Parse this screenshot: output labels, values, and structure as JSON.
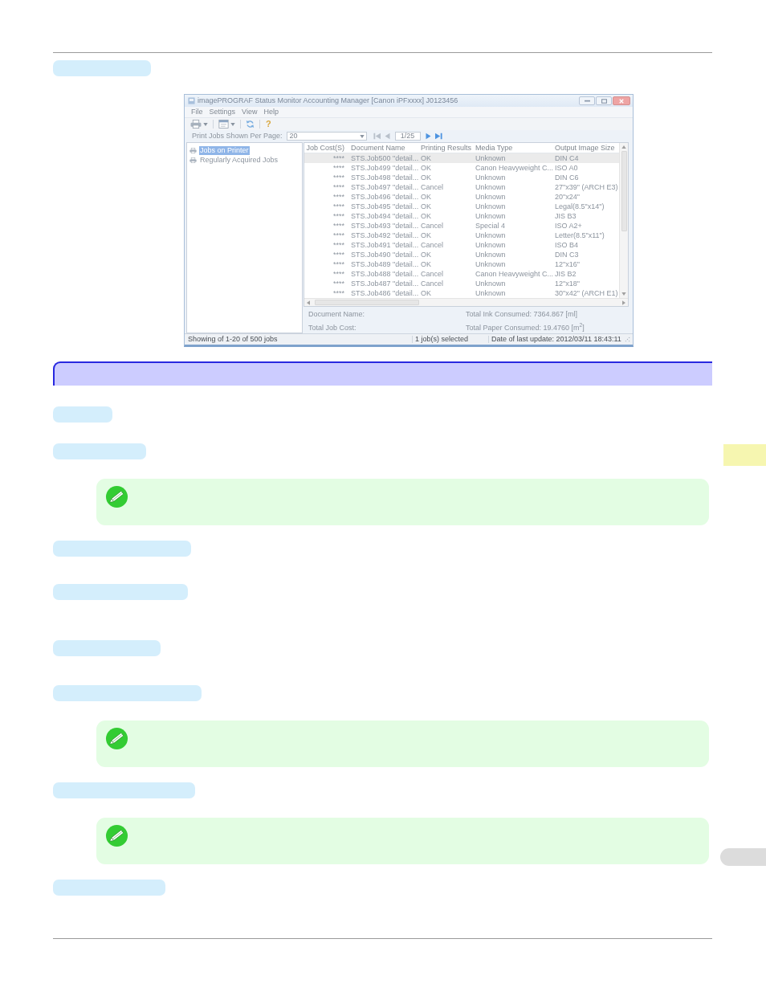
{
  "page": {
    "blocks": [
      {
        "kind": "bar"
      },
      {
        "kind": "screenshot",
        "window": {
          "title": "imagePROGRAF Status Monitor Accounting Manager [Canon iPFxxxx] J0123456",
          "menu": [
            "File",
            "Settings",
            "View",
            "Help"
          ],
          "toolbar": [
            {
              "kind": "printer-menu"
            },
            {
              "kind": "document-menu"
            },
            {
              "kind": "refresh"
            },
            {
              "kind": "help",
              "glyph": "?"
            }
          ],
          "per_page": {
            "label": "Print Jobs Shown Per Page:",
            "value": "20"
          },
          "pager": [
            {
              "kind": "first",
              "disabled": true
            },
            {
              "kind": "previous",
              "disabled": true
            },
            {
              "kind": "page",
              "value": "1/25"
            },
            {
              "kind": "next",
              "disabled": false
            },
            {
              "kind": "last",
              "disabled": false
            }
          ],
          "tree": [
            {
              "label": "Jobs on Printer",
              "selected": true
            },
            {
              "label": "Regularly Acquired Jobs",
              "selected": false
            }
          ],
          "table": {
            "columns": [
              "Job Cost(S)",
              "Document Name",
              "Printing Results",
              "Media Type",
              "Output Image Size"
            ],
            "rows": [
              {
                "cells": [
                  "****",
                  "STS.Job500 \"detail...",
                  "OK",
                  "Unknown",
                  "DIN C4"
                ],
                "selected": true
              },
              {
                "cells": [
                  "****",
                  "STS.Job499 \"detail...",
                  "OK",
                  "Canon Heavyweight C...",
                  "ISO A0"
                ],
                "selected": false
              },
              {
                "cells": [
                  "****",
                  "STS.Job498 \"detail...",
                  "OK",
                  "Unknown",
                  "DIN C6"
                ],
                "selected": false
              },
              {
                "cells": [
                  "****",
                  "STS.Job497 \"detail...",
                  "Cancel",
                  "Unknown",
                  "27\"x39\" (ARCH E3)"
                ],
                "selected": false
              },
              {
                "cells": [
                  "****",
                  "STS.Job496 \"detail...",
                  "OK",
                  "Unknown",
                  "20\"x24\""
                ],
                "selected": false
              },
              {
                "cells": [
                  "****",
                  "STS.Job495 \"detail...",
                  "OK",
                  "Unknown",
                  "Legal(8.5\"x14\")"
                ],
                "selected": false
              },
              {
                "cells": [
                  "****",
                  "STS.Job494 \"detail...",
                  "OK",
                  "Unknown",
                  "JIS B3"
                ],
                "selected": false
              },
              {
                "cells": [
                  "****",
                  "STS.Job493 \"detail...",
                  "Cancel",
                  "Special 4",
                  "ISO A2+"
                ],
                "selected": false
              },
              {
                "cells": [
                  "****",
                  "STS.Job492 \"detail...",
                  "OK",
                  "Unknown",
                  "Letter(8.5\"x11\")"
                ],
                "selected": false
              },
              {
                "cells": [
                  "****",
                  "STS.Job491 \"detail...",
                  "Cancel",
                  "Unknown",
                  "ISO B4"
                ],
                "selected": false
              },
              {
                "cells": [
                  "****",
                  "STS.Job490 \"detail...",
                  "OK",
                  "Unknown",
                  "DIN C3"
                ],
                "selected": false
              },
              {
                "cells": [
                  "****",
                  "STS.Job489 \"detail...",
                  "OK",
                  "Unknown",
                  "12\"x16\""
                ],
                "selected": false
              },
              {
                "cells": [
                  "****",
                  "STS.Job488 \"detail...",
                  "Cancel",
                  "Canon Heavyweight C...",
                  "JIS B2"
                ],
                "selected": false
              },
              {
                "cells": [
                  "****",
                  "STS.Job487 \"detail...",
                  "Cancel",
                  "Unknown",
                  "12\"x18\""
                ],
                "selected": false
              },
              {
                "cells": [
                  "****",
                  "STS.Job486 \"detail...",
                  "OK",
                  "Unknown",
                  "30\"x42\" (ARCH E1)"
                ],
                "selected": false
              }
            ]
          },
          "details": {
            "left": [
              "Document Name:",
              "Total Job Cost:"
            ],
            "right": [
              "Total Ink Consumed: 7364.867 [ml]",
              "Total Paper Consumed: 19.4760 [m$^{2}$]"
            ]
          },
          "status_bar": [
            "Showing of 1-20 of 500 jobs",
            "1 job(s) selected",
            "Date of last update: 2012/03/11 18:43:11"
          ]
        }
      },
      {
        "kind": "heading"
      },
      {
        "kind": "bar"
      },
      {
        "kind": "bar"
      },
      {
        "kind": "note"
      },
      {
        "kind": "bar"
      },
      {
        "kind": "bar"
      },
      {
        "kind": "bar"
      },
      {
        "kind": "bar"
      },
      {
        "kind": "note"
      },
      {
        "kind": "bar"
      },
      {
        "kind": "note"
      },
      {
        "kind": "bar"
      }
    ],
    "margin_tabs": [
      {
        "kind": "chapter"
      },
      {
        "kind": "page"
      }
    ]
  }
}
